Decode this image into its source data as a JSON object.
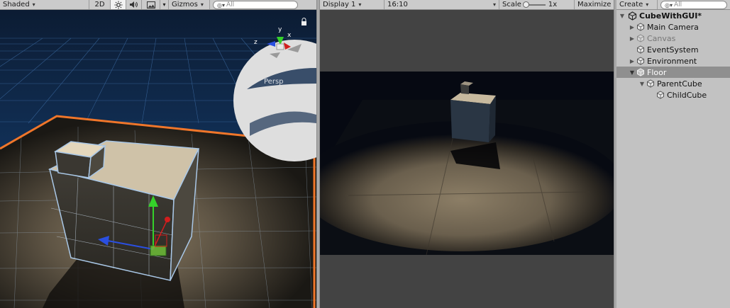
{
  "scene_toolbar": {
    "shading_mode": "Shaded",
    "mode_2d": "2D",
    "icons": [
      "lighting-icon",
      "audio-icon",
      "image-effects-icon"
    ],
    "gizmos": "Gizmos",
    "search_placeholder": "All"
  },
  "scene_view": {
    "gizmo_axes": [
      "y",
      "z",
      "x"
    ],
    "persp_label": "Persp"
  },
  "game_toolbar": {
    "display": "Display 1",
    "aspect": "16:10",
    "scale_label": "Scale",
    "scale_value": "1x",
    "maximize": "Maximize"
  },
  "hierarchy_toolbar": {
    "create": "Create",
    "search_placeholder": "All"
  },
  "hierarchy": {
    "root": "CubeWithGUI*",
    "items": [
      {
        "label": "Main Camera",
        "depth": 1,
        "arrow": "▶",
        "dim": false
      },
      {
        "label": "Canvas",
        "depth": 1,
        "arrow": "▶",
        "dim": true
      },
      {
        "label": "EventSystem",
        "depth": 1,
        "arrow": "",
        "dim": false
      },
      {
        "label": "Environment",
        "depth": 1,
        "arrow": "▶",
        "dim": false
      },
      {
        "label": "Floor",
        "depth": 1,
        "arrow": "▼",
        "dim": false,
        "selected": true
      },
      {
        "label": "ParentCube",
        "depth": 2,
        "arrow": "▼",
        "dim": false
      },
      {
        "label": "ChildCube",
        "depth": 3,
        "arrow": "",
        "dim": false
      }
    ]
  },
  "colors": {
    "selection_outline": "#f0762a",
    "y_axis": "#35d12a",
    "x_axis": "#d11e1e",
    "z_axis": "#2a4fe0"
  }
}
